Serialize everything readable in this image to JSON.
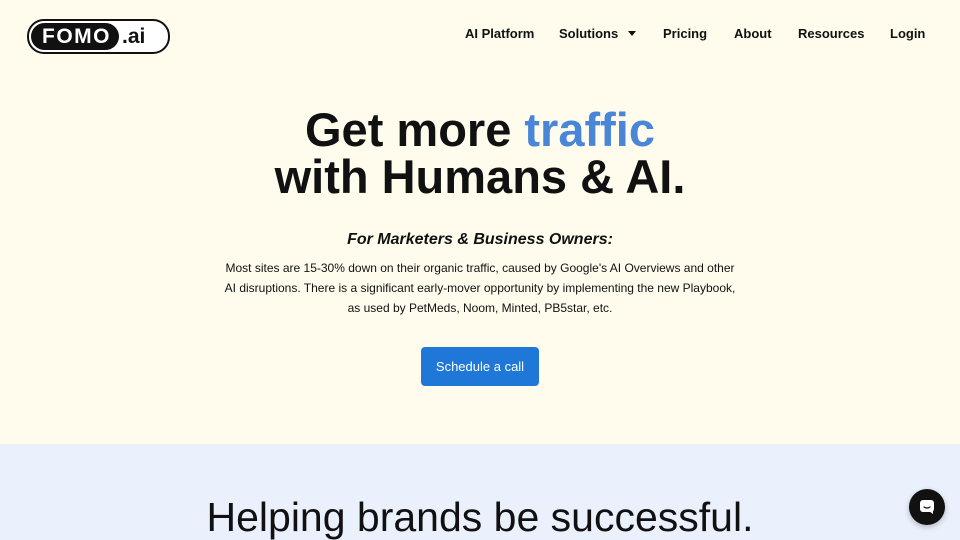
{
  "header": {
    "logo": {
      "main": "FOMO",
      "suffix": ".ai"
    },
    "nav": {
      "ai_platform": "AI Platform",
      "solutions": "Solutions",
      "pricing": "Pricing",
      "about": "About",
      "resources": "Resources",
      "login": "Login"
    }
  },
  "hero": {
    "title_part1": "Get more ",
    "title_accent": "traffic",
    "title_line2": "with Humans & AI.",
    "subtitle": "For Marketers & Business Owners:",
    "body": "Most sites are 15-30% down on their organic traffic, caused by Google's AI Overviews and other AI disruptions. There is a significant early-mover opportunity by implementing the new Playbook, as used by PetMeds, Noom, Minted, PB5star, etc.",
    "cta": "Schedule a call"
  },
  "section2": {
    "title": "Helping brands be successful."
  },
  "colors": {
    "background": "#fffcee",
    "accent": "#4a86d8",
    "button": "#1f78d8",
    "section2_bg": "#eaf1fc"
  },
  "icons": {
    "chat": "chat-bubble-icon",
    "dropdown": "chevron-down-icon"
  }
}
